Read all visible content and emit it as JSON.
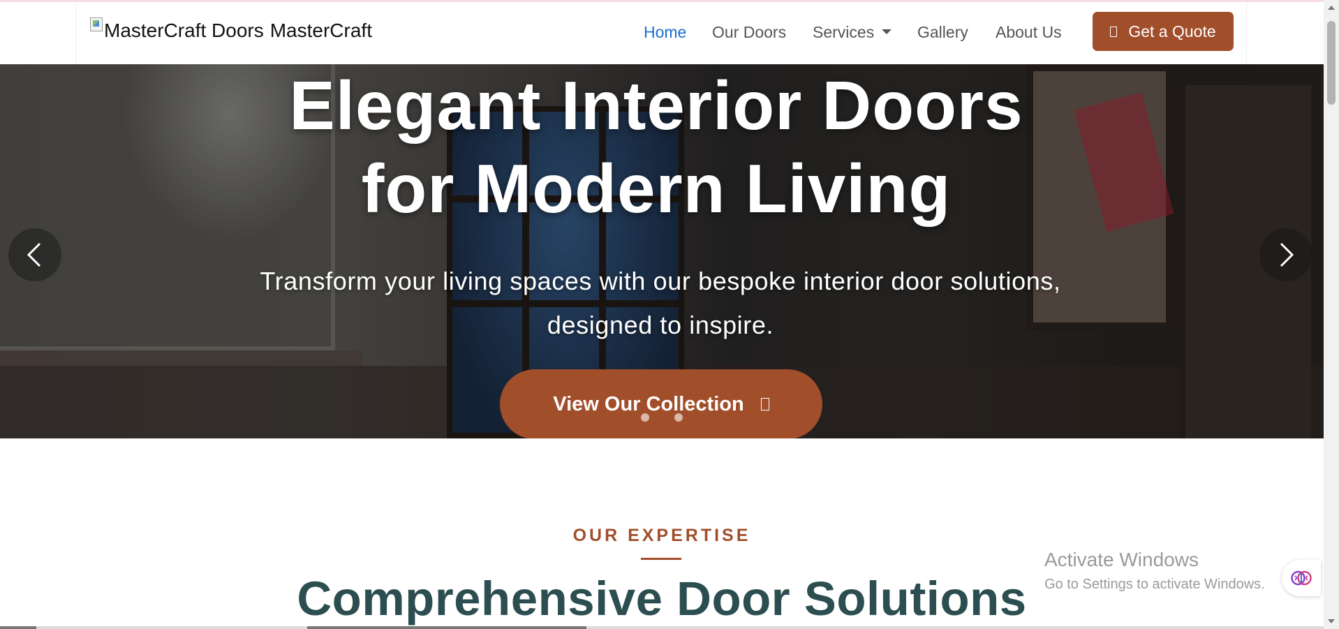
{
  "brand": {
    "logo_alt": "MasterCraft Doors",
    "name": "MasterCraft"
  },
  "nav": {
    "home": "Home",
    "doors": "Our Doors",
    "services": "Services",
    "gallery": "Gallery",
    "about": "About Us",
    "quote": "Get a Quote"
  },
  "hero": {
    "title_line1": "Elegant Interior Doors",
    "title_line2": "for Modern Living",
    "subtitle_line1": "Transform your living spaces with our bespoke interior door solutions,",
    "subtitle_line2": "designed to inspire.",
    "cta": "View Our Collection"
  },
  "expertise": {
    "eyebrow": "OUR EXPERTISE",
    "title": "Comprehensive Door Solutions"
  },
  "watermark": {
    "title": "Activate Windows",
    "subtitle": "Go to Settings to activate Windows."
  },
  "colors": {
    "accent": "#a14e2b",
    "nav_active": "#1c6dd0",
    "heading_teal": "#2c4e50"
  },
  "icons": {
    "quote": "document-icon",
    "cta": "arrow-right-icon",
    "prev": "chevron-left-icon",
    "next": "chevron-right-icon",
    "extension": "brain-icon"
  }
}
